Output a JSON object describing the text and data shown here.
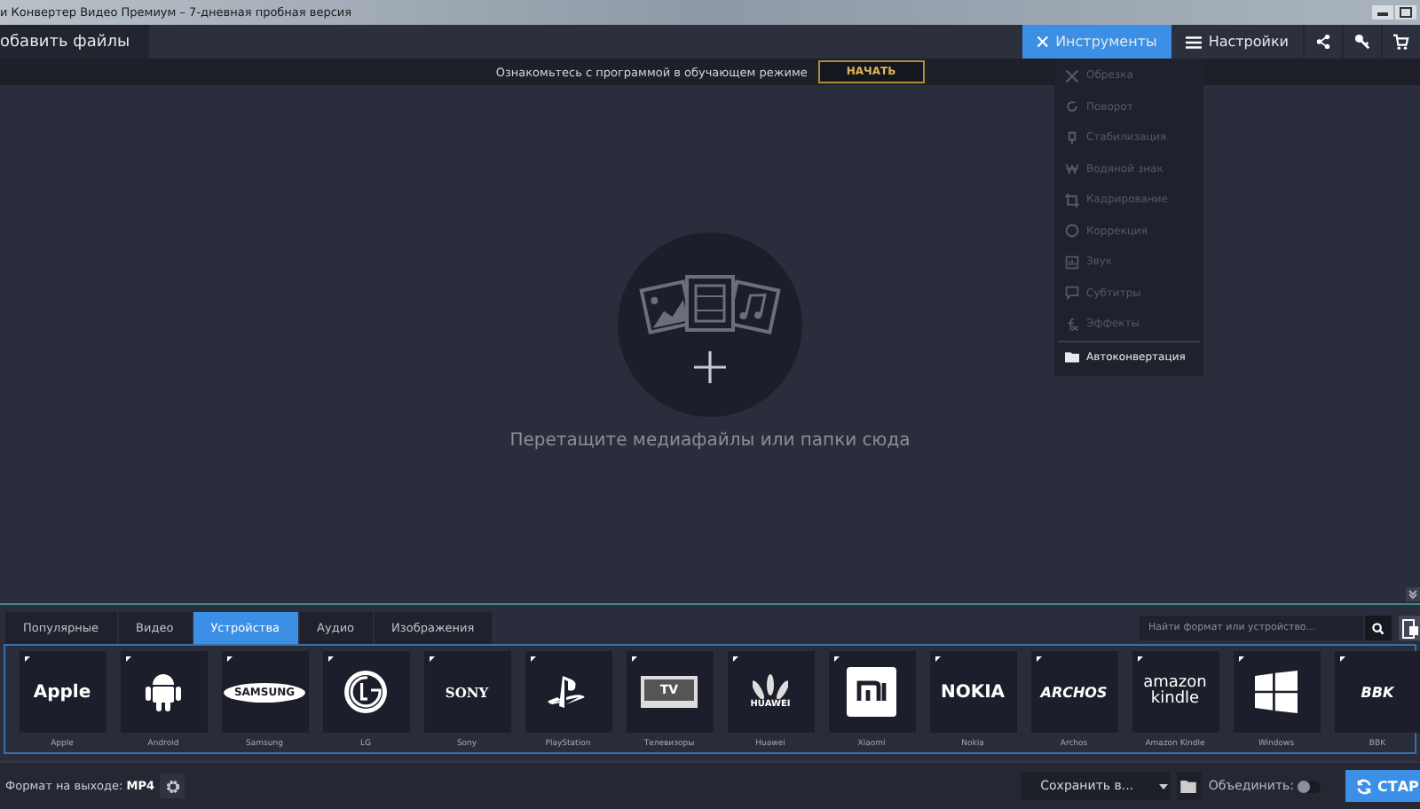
{
  "window": {
    "title": "и Конвертер Видео Премиум – 7-дневная пробная версия"
  },
  "toolbar": {
    "add_files": "обавить файлы",
    "tools": {
      "label": "Инструменты",
      "selected": true
    },
    "settings": {
      "label": "Настройки",
      "selected": false
    }
  },
  "tutorial": {
    "text": "Ознакомьтесь с программой в обучающем режиме",
    "button": "НАЧАТЬ"
  },
  "tools_menu": [
    {
      "label": "Обрезка",
      "kind": "cut",
      "disabled": true
    },
    {
      "label": "Поворот",
      "kind": "rotate",
      "disabled": true
    },
    {
      "label": "Стабилизация",
      "kind": "stabilize",
      "disabled": true
    },
    {
      "label": "Водяной знак",
      "kind": "watermark",
      "disabled": true
    },
    {
      "label": "Кадрирование",
      "kind": "crop",
      "disabled": true
    },
    {
      "label": "Коррекция",
      "kind": "correct",
      "disabled": true
    },
    {
      "label": "Звук",
      "kind": "sound",
      "disabled": true
    },
    {
      "label": "Субтитры",
      "kind": "subtitles",
      "disabled": true
    },
    {
      "label": "Эффекты",
      "kind": "effects",
      "disabled": true
    },
    {
      "label": "Автоконвертация",
      "kind": "auto",
      "disabled": false
    }
  ],
  "drop_zone": {
    "text": "Перетащите медиафайлы или папки сюда"
  },
  "format_tabs": [
    {
      "label": "Популярные",
      "selected": false
    },
    {
      "label": "Видео",
      "selected": false
    },
    {
      "label": "Устройства",
      "selected": true
    },
    {
      "label": "Аудио",
      "selected": false
    },
    {
      "label": "Изображения",
      "selected": false
    }
  ],
  "search": {
    "placeholder": "Найти формат или устройство..."
  },
  "devices": [
    {
      "label": "Apple",
      "kind": "text",
      "logo": "Apple"
    },
    {
      "label": "Android",
      "kind": "android"
    },
    {
      "label": "Samsung",
      "kind": "oval",
      "logo": "SAMSUNG"
    },
    {
      "label": "LG",
      "kind": "lg"
    },
    {
      "label": "Sony",
      "kind": "serif",
      "logo": "SONY"
    },
    {
      "label": "PlayStation",
      "kind": "playstation"
    },
    {
      "label": "Телевизоры",
      "kind": "tv",
      "logo": "TV"
    },
    {
      "label": "Huawei",
      "kind": "huawei",
      "logo": "HUAWEI"
    },
    {
      "label": "Xiaomi",
      "kind": "mi"
    },
    {
      "label": "Nokia",
      "kind": "text",
      "logo": "NOKIA"
    },
    {
      "label": "Archos",
      "kind": "italic",
      "logo": "ARCHOS"
    },
    {
      "label": "Amazon Kindle",
      "kind": "stack",
      "logo": "amazon",
      "logo2": "kindle"
    },
    {
      "label": "Windows",
      "kind": "windows"
    },
    {
      "label": "BBK",
      "kind": "italic",
      "logo": "BBK"
    }
  ],
  "bottom_bar": {
    "format_label": "Формат на выходе:",
    "format_value": "MP4",
    "save": "Сохранить в...",
    "merge": {
      "label": "Объединить:",
      "on": false
    },
    "start": "СТАР"
  }
}
